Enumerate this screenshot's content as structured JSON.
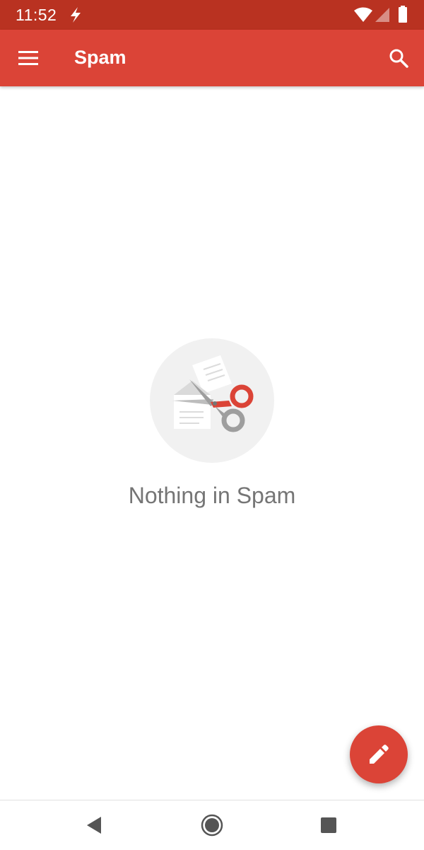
{
  "status_bar": {
    "time": "11:52",
    "icons": [
      "flash-icon",
      "wifi-icon",
      "signal-icon",
      "battery-icon"
    ]
  },
  "app_bar": {
    "title": "Spam",
    "left_icon": "menu-icon",
    "right_icon": "search-icon",
    "background": "#db4437"
  },
  "empty_state": {
    "illustration": "scissors-cutting-mail-illustration",
    "message": "Nothing in Spam"
  },
  "fab": {
    "icon": "pencil-icon",
    "color": "#db4437"
  },
  "nav_bar": {
    "icons": [
      "back-icon",
      "home-icon",
      "recents-icon"
    ]
  },
  "colors": {
    "status_bar": "#b93221",
    "accent": "#db4437",
    "empty_text": "#757575"
  }
}
